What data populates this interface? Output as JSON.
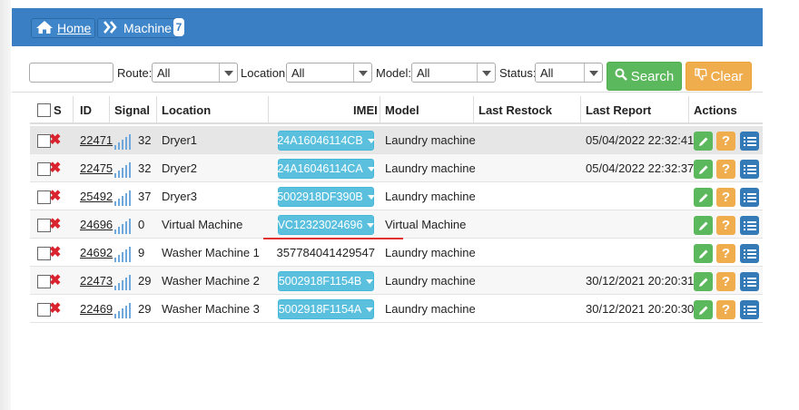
{
  "breadcrumb": {
    "home_label": "Home",
    "current_label": "Machine",
    "count": "7"
  },
  "filters": {
    "search_value": "",
    "route_label": "Route:",
    "route_value": "All",
    "location_label": "Location:",
    "location_value": "All",
    "model_label": "Model:",
    "model_value": "All",
    "status_label": "Status:",
    "status_value": "All",
    "search_button": "Search",
    "clear_button": "Clear"
  },
  "table": {
    "headers": [
      "S",
      "ID",
      "Signal",
      "Location",
      "IMEI",
      "Model",
      "Last Restock",
      "Last Report",
      "Actions"
    ],
    "rows": [
      {
        "id": "22471",
        "signal": "32",
        "location": "Dryer1",
        "imei": "24A16046114CB",
        "imei_button": true,
        "model": "Laundry machine",
        "last_restock": "",
        "last_report": "05/04/2022 22:32:41"
      },
      {
        "id": "22475",
        "signal": "32",
        "location": "Dryer2",
        "imei": "24A16046114CA",
        "imei_button": true,
        "model": "Laundry machine",
        "last_restock": "",
        "last_report": "05/04/2022 22:32:37"
      },
      {
        "id": "25492",
        "signal": "37",
        "location": "Dryer3",
        "imei": "5002918DF390B",
        "imei_button": true,
        "model": "Laundry machine",
        "last_restock": "",
        "last_report": ""
      },
      {
        "id": "24696",
        "signal": "0",
        "location": "Virtual Machine",
        "imei": "VC12323024696",
        "imei_button": true,
        "model": "Virtual Machine",
        "last_restock": "",
        "last_report": ""
      },
      {
        "id": "24692",
        "signal": "9",
        "location": "Washer Machine 1",
        "imei": "357784041429547",
        "imei_button": false,
        "model": "Laundry machine",
        "last_restock": "",
        "last_report": ""
      },
      {
        "id": "22473",
        "signal": "29",
        "location": "Washer Machine 2",
        "imei": "5002918F1154B",
        "imei_button": true,
        "model": "Laundry machine",
        "last_restock": "",
        "last_report": "30/12/2021 20:20:31"
      },
      {
        "id": "22469",
        "signal": "29",
        "location": "Washer Machine 3",
        "imei": "5002918F1154A",
        "imei_button": true,
        "model": "Laundry machine",
        "last_restock": "",
        "last_report": "30/12/2021 20:20:30"
      }
    ]
  },
  "colors": {
    "topbar": "#3a7fc4",
    "search_button": "#5cb85c",
    "clear_button": "#f0ad4e",
    "imei_button": "#5bc0de",
    "delete_mark": "#d9232e",
    "edit_action": "#5cb85c",
    "help_action": "#f0ad4e",
    "list_action": "#337ab7"
  },
  "icons": {
    "home": "home-icon",
    "breadcrumb_separator": "double-chevron-right-icon",
    "search": "search-icon",
    "clear": "thumbs-down-icon",
    "delete": "close-icon",
    "signal": "signal-bars-icon",
    "edit": "pencil-icon",
    "help": "question-icon",
    "list": "list-icon"
  }
}
